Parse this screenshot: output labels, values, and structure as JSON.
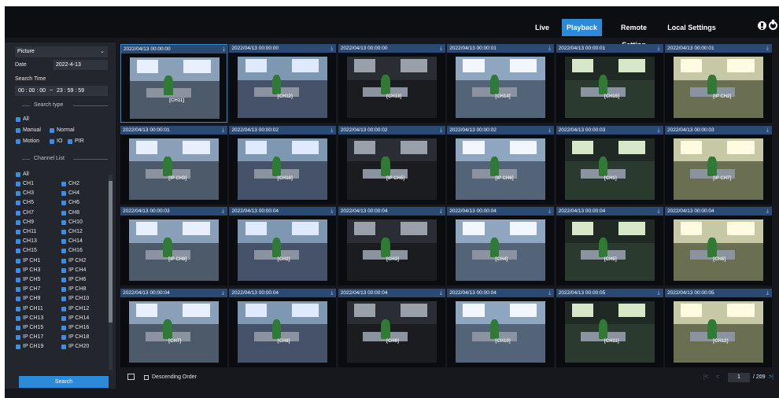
{
  "nav": {
    "items": [
      {
        "label": "Live",
        "active": false
      },
      {
        "label": "Playback",
        "active": true
      },
      {
        "label": "Remote Setting",
        "active": false
      },
      {
        "label": "Local Settings",
        "active": false
      }
    ],
    "icons": [
      "info-icon",
      "power-icon"
    ]
  },
  "sidebar": {
    "type_select": "Picture",
    "date_label": "Date",
    "date_value": "2022-4-13",
    "search_time_label": "Search Time",
    "time_start": "00 : 00 : 00",
    "time_sep": "~",
    "time_end": "23 : 59 : 59",
    "search_type_header": "Search type",
    "search_types": [
      "All",
      "Manual",
      "Normal",
      "Motion",
      "IO",
      "PIR"
    ],
    "channel_list_header": "Channel List",
    "channels": [
      "All",
      "CH1",
      "CH2",
      "CH3",
      "CH4",
      "CH5",
      "CH6",
      "CH7",
      "CH8",
      "CH9",
      "CH10",
      "CH11",
      "CH12",
      "CH13",
      "CH14",
      "CH15",
      "CH16",
      "IP CH1",
      "IP CH2",
      "IP CH3",
      "IP CH4",
      "IP CH5",
      "IP CH6",
      "IP CH7",
      "IP CH8",
      "IP CH9",
      "IP CH10",
      "IP CH11",
      "IP CH12",
      "IP CH13",
      "IP CH14",
      "IP CH15",
      "IP CH16",
      "IP CH17",
      "IP CH18",
      "IP CH19",
      "IP CH20"
    ],
    "search_button": "Search"
  },
  "grid": {
    "tiles": [
      {
        "time": "2022/04/13 00:00:00",
        "ch": "[CH11]"
      },
      {
        "time": "2022/04/13 00:00:00",
        "ch": "[CH12]"
      },
      {
        "time": "2022/04/13 00:00:00",
        "ch": "[CH13]"
      },
      {
        "time": "2022/04/13 00:00:01",
        "ch": "[CH14]"
      },
      {
        "time": "2022/04/13 00:00:01",
        "ch": "[CH15]"
      },
      {
        "time": "2022/04/13 00:00:01",
        "ch": "[IP CH2]"
      },
      {
        "time": "2022/04/13 00:00:01",
        "ch": "[IP CH3]"
      },
      {
        "time": "2022/04/13 00:00:02",
        "ch": "[CH16]"
      },
      {
        "time": "2022/04/13 00:00:02",
        "ch": "[IP CH5]"
      },
      {
        "time": "2022/04/13 00:00:02",
        "ch": "[IP CH6]"
      },
      {
        "time": "2022/04/13 00:00:03",
        "ch": "[CH1]"
      },
      {
        "time": "2022/04/13 00:00:03",
        "ch": "[IP CH7]"
      },
      {
        "time": "2022/04/13 00:00:03",
        "ch": "[IP CH8]"
      },
      {
        "time": "2022/04/13 00:00:04",
        "ch": "[CH2]"
      },
      {
        "time": "2022/04/13 00:00:04",
        "ch": "[CH3]"
      },
      {
        "time": "2022/04/13 00:00:04",
        "ch": "[CH4]"
      },
      {
        "time": "2022/04/13 00:00:04",
        "ch": "[CH5]"
      },
      {
        "time": "2022/04/13 00:00:04",
        "ch": "[CH6]"
      },
      {
        "time": "2022/04/13 00:00:04",
        "ch": "[CH7]"
      },
      {
        "time": "2022/04/13 00:00:04",
        "ch": "[CH8]"
      },
      {
        "time": "2022/04/13 00:00:04",
        "ch": "[CH9]"
      },
      {
        "time": "2022/04/13 00:00:04",
        "ch": "[CH10]"
      },
      {
        "time": "2022/04/13 00:00:05",
        "ch": "[CH11]"
      },
      {
        "time": "2022/04/13 00:00:05",
        "ch": "[CH12]"
      }
    ]
  },
  "footer": {
    "descending_label": "Descending Order",
    "page_current": "1",
    "page_total": "/ 209",
    "icons": [
      "first-page-icon",
      "prev-page-icon",
      "next-page-icon",
      "last-page-icon"
    ]
  },
  "colors": {
    "accent": "#2c8ad8",
    "panel": "#23262d",
    "background": "#16181d"
  }
}
